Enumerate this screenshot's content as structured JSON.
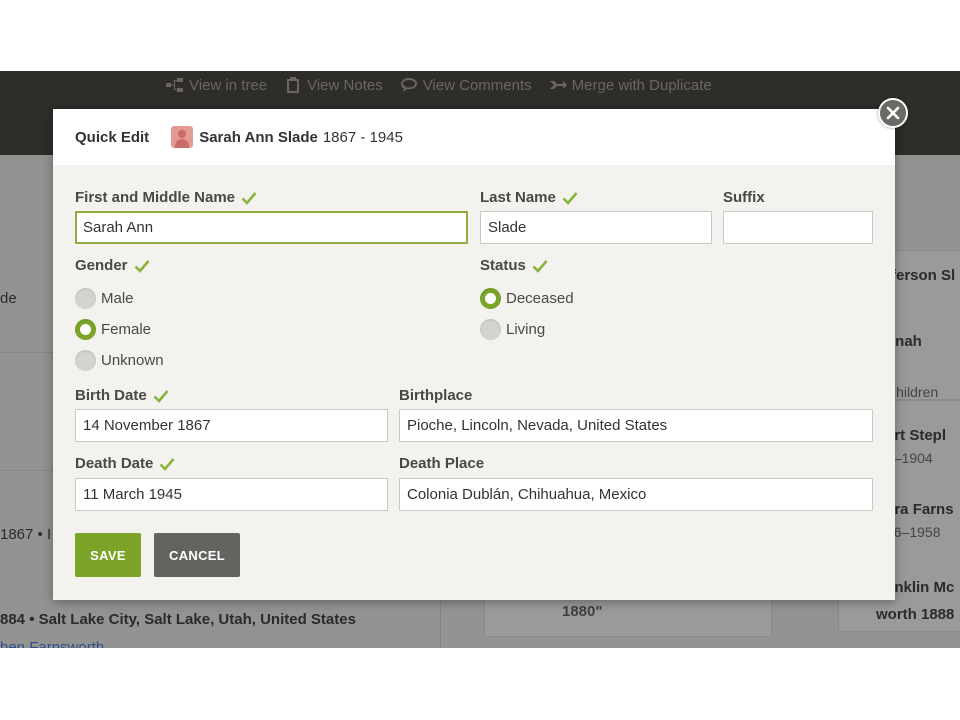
{
  "toolbar": {
    "actions": [
      {
        "label": "View in tree",
        "icon": "tree-icon"
      },
      {
        "label": "View Notes",
        "icon": "notes-icon"
      },
      {
        "label": "View Comments",
        "icon": "comments-icon"
      },
      {
        "label": "Merge with Duplicate",
        "icon": "merge-icon"
      }
    ]
  },
  "background": {
    "left_fragment_1": "de",
    "left_fragment_2": "1867 • I",
    "residence_line": "884 • Salt Lake City, Salt Lake, Utah, United States",
    "bottom_fragment": "hen Farnsworth",
    "middle_fragment": "1880\"",
    "right_1": "fferson Sl",
    "right_2": "nnah",
    "right_3": "Children",
    "right_4a": "ert Stepl",
    "right_4b": "4–1904",
    "right_5a": "ara Farns",
    "right_5b": "86–1958",
    "right_6a": "anklin Mc",
    "right_6b": "worth 1888"
  },
  "modal": {
    "title": "Quick Edit",
    "person_name": "Sarah Ann Slade",
    "person_dates": "1867 - 1945",
    "fields": {
      "first_middle": {
        "label": "First and Middle Name",
        "value": "Sarah Ann"
      },
      "last_name": {
        "label": "Last Name",
        "value": "Slade"
      },
      "suffix": {
        "label": "Suffix",
        "value": ""
      },
      "gender": {
        "label": "Gender",
        "options": [
          "Male",
          "Female",
          "Unknown"
        ],
        "selected": "Female"
      },
      "status": {
        "label": "Status",
        "options": [
          "Deceased",
          "Living"
        ],
        "selected": "Deceased"
      },
      "birth_date": {
        "label": "Birth Date",
        "value": "14 November 1867"
      },
      "birthplace": {
        "label": "Birthplace",
        "value": "Pioche, Lincoln, Nevada, United States"
      },
      "death_date": {
        "label": "Death Date",
        "value": "11 March 1945"
      },
      "death_place": {
        "label": "Death Place",
        "value": "Colonia Dublán, Chihuahua, Mexico"
      }
    },
    "buttons": {
      "save": "SAVE",
      "cancel": "CANCEL"
    }
  },
  "colors": {
    "accent_green": "#7ba428",
    "check_green": "#8ab33a",
    "cancel_gray": "#65635f",
    "header_dark": "#2f2d2a"
  }
}
